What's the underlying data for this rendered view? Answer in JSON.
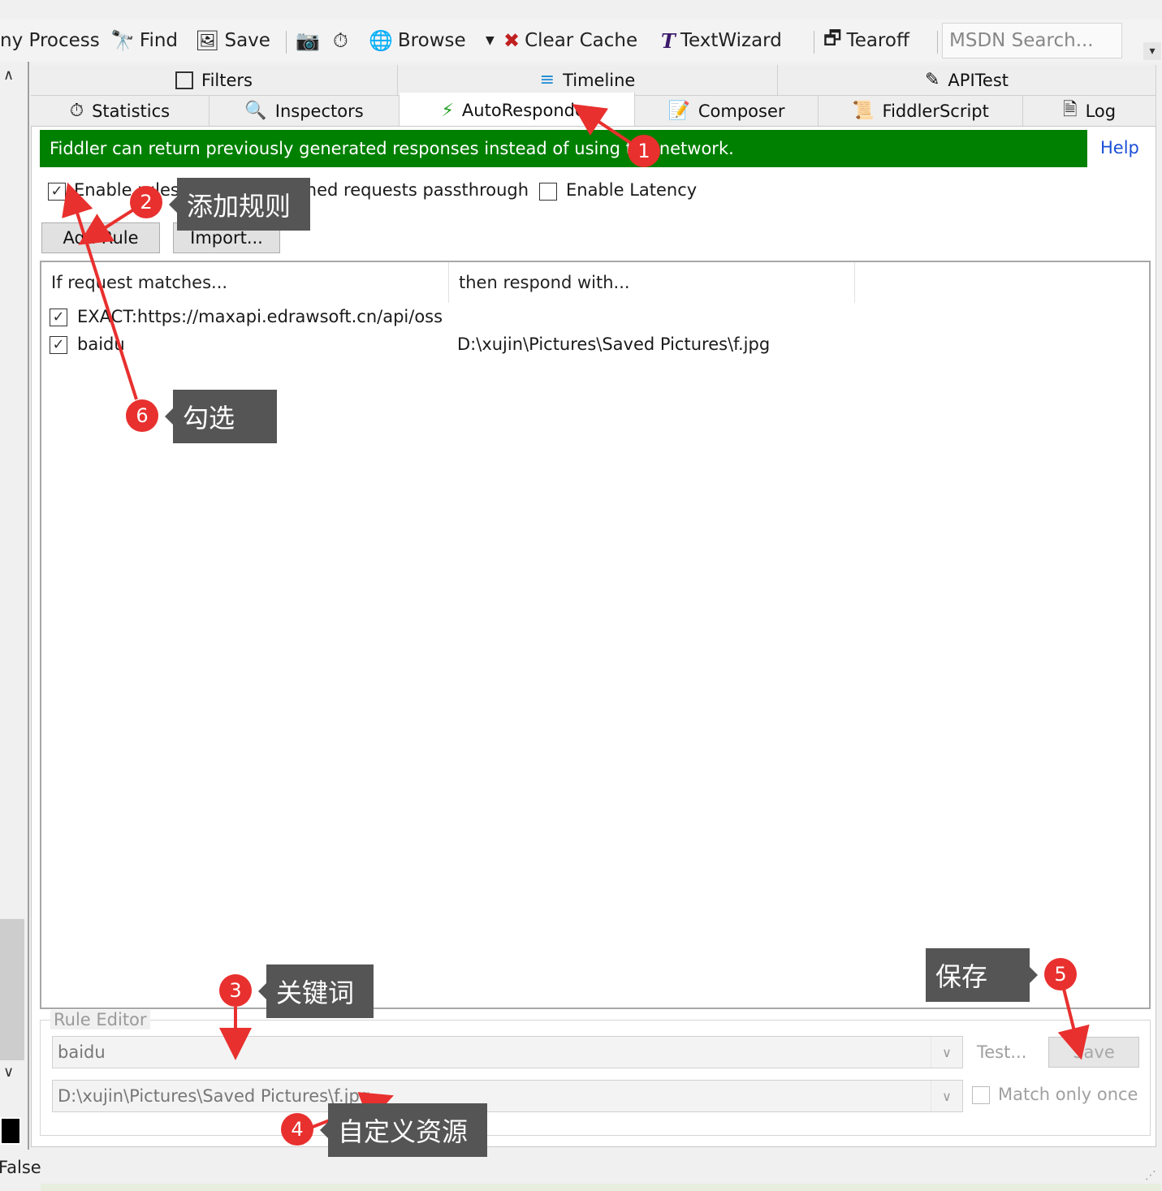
{
  "toolbar": {
    "any_process": "ny Process",
    "find": "Find",
    "save": "Save",
    "browse": "Browse",
    "clear_cache": "Clear Cache",
    "textwizard": "TextWizard",
    "tearoff": "Tearoff",
    "msdn_search": "MSDN Search..."
  },
  "tabs_top": [
    {
      "label": "Filters",
      "icon": "checkbox-icon"
    },
    {
      "label": "Timeline",
      "icon": "timeline-icon"
    },
    {
      "label": "APITest",
      "icon": "pencil-icon"
    }
  ],
  "tabs_bottom": [
    {
      "label": "Statistics",
      "icon": "stopwatch-icon"
    },
    {
      "label": "Inspectors",
      "icon": "magnifier-icon"
    },
    {
      "label": "AutoResponder",
      "icon": "lightning-icon",
      "active": true
    },
    {
      "label": "Composer",
      "icon": "compose-icon"
    },
    {
      "label": "FiddlerScript",
      "icon": "script-icon"
    },
    {
      "label": "Log",
      "icon": "log-icon"
    }
  ],
  "banner": {
    "text": "Fiddler can return previously generated responses instead of using the network.",
    "help": "Help",
    "color": "#008000"
  },
  "options": {
    "enable_rules": "Enable rules",
    "unmatched": "Unmatched requests passthrough",
    "enable_latency": "Enable Latency"
  },
  "buttons": {
    "add_rule": "Add Rule",
    "import": "Import..."
  },
  "rules_table": {
    "headers": [
      "If request matches...",
      "then respond with..."
    ],
    "rows": [
      {
        "match": "EXACT:https://maxapi.edrawsoft.cn/api/oss...",
        "respond": "",
        "checked": true
      },
      {
        "match": "baidu",
        "respond": "D:\\xujin\\Pictures\\Saved Pictures\\f.jpg",
        "checked": true
      }
    ]
  },
  "rule_editor": {
    "title": "Rule Editor",
    "match_value": "baidu",
    "respond_value": "D:\\xujin\\Pictures\\Saved Pictures\\f.jpg",
    "test": "Test...",
    "save": "Save",
    "match_only_once": "Match only once"
  },
  "status": {
    "text": "False"
  },
  "annotations": {
    "badge1": "1",
    "badge2": "2",
    "badge3": "3",
    "badge4": "4",
    "badge5": "5",
    "badge6": "6",
    "tip2": "添加规则",
    "tip3": "关键词",
    "tip4": "自定义资源",
    "tip5": "保存",
    "tip6": "勾选",
    "color": "#e8302e"
  }
}
